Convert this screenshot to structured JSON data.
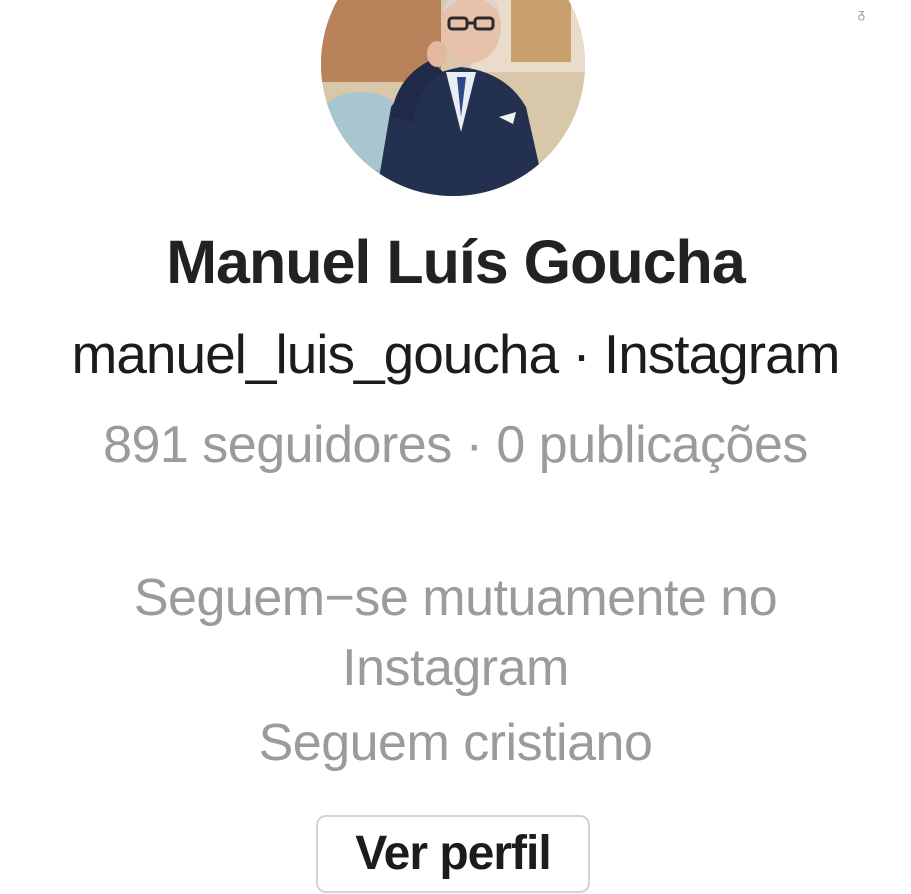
{
  "profile": {
    "name": "Manuel Luís Goucha",
    "handle_line": "manuel_luis_goucha · Instagram",
    "stats_line": "891 seguidores · 0 publicações",
    "mutual_line": "Seguem−se mutuamente no Instagram",
    "follows_line": "Seguem cristiano",
    "avatar_icon": "profile-photo"
  },
  "actions": {
    "view_profile_label": "Ver perfil"
  },
  "colors": {
    "primary_text": "#222222",
    "muted_text": "#9b9b9b",
    "button_border": "#d4d4d4"
  }
}
